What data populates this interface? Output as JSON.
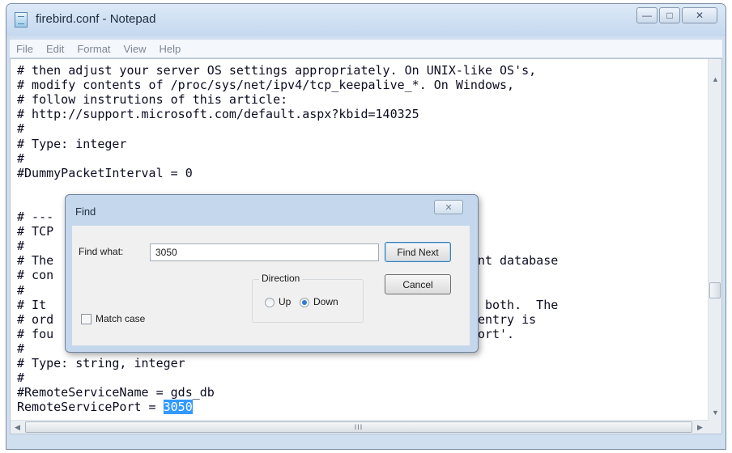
{
  "window": {
    "title": "firebird.conf - Notepad",
    "controls": {
      "minimize": "—",
      "maximize": "□",
      "close": "✕"
    }
  },
  "menu": [
    "File",
    "Edit",
    "Format",
    "View",
    "Help"
  ],
  "editor": {
    "lines": [
      "# then adjust your server OS settings appropriately. On UNIX-like OS's,",
      "# modify contents of /proc/sys/net/ipv4/tcp_keepalive_*. On Windows,",
      "# follow instrutions of this article:",
      "# http://support.microsoft.com/default.aspx?kbid=140325",
      "#",
      "# Type: integer",
      "#",
      "#DummyPacketInterval = 0",
      "",
      "",
      "# ---",
      "# TCP",
      "#",
      "# The                                                       lient database",
      "# con",
      "#",
      "# It                                                      , not both.  The",
      "# ord                                                     f an entry is",
      "# fou                                                     vicePort'.",
      "#",
      "# Type: string, integer",
      "#",
      "#RemoteServiceName = gds_db"
    ],
    "last_line_prefix": "RemoteServicePort = ",
    "selected_text": "3050"
  },
  "scrollbars": {
    "up": "▲",
    "down": "▼",
    "left": "◀",
    "right": "▶",
    "grip": "III"
  },
  "find_dialog": {
    "title": "Find",
    "close": "✕",
    "find_what_label": "Find what:",
    "find_what_value": "3050",
    "find_next_label": "Find Next",
    "cancel_label": "Cancel",
    "direction_label": "Direction",
    "up_label": "Up",
    "down_label": "Down",
    "direction_selected": "Down",
    "match_case_label": "Match case",
    "match_case_checked": false
  }
}
